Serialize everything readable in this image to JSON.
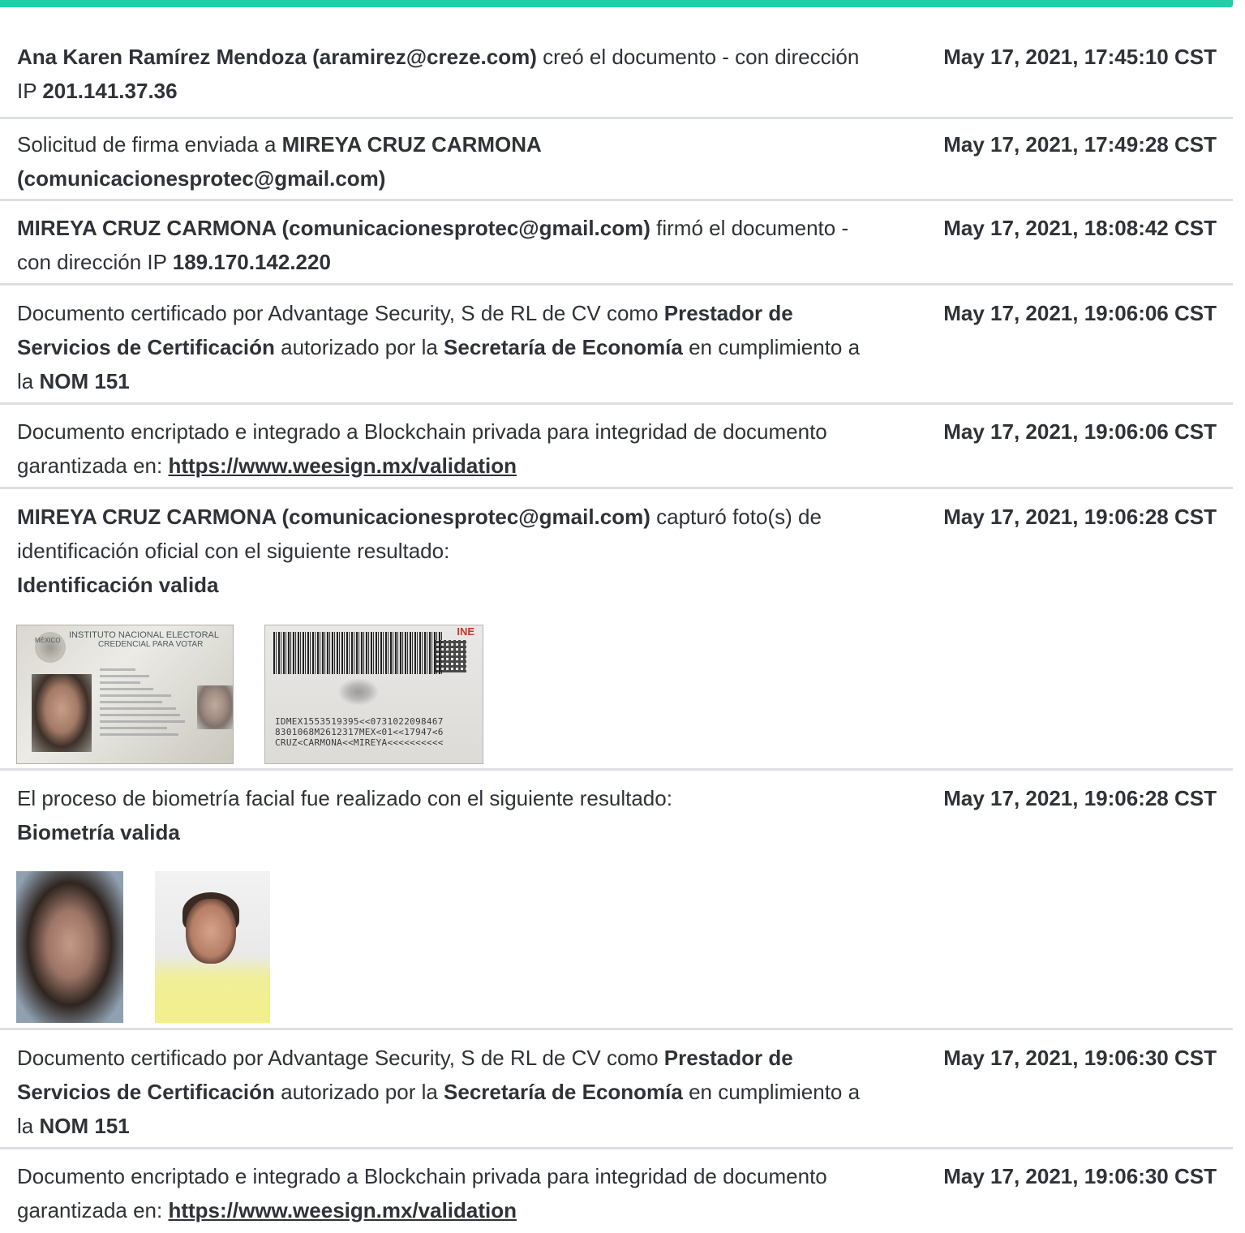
{
  "accent_color": "#20cfa8",
  "events": [
    {
      "parts": [
        {
          "t": "Ana Karen Ramírez Mendoza (aramirez@creze.com)",
          "b": true
        },
        {
          "t": " creó el documento - con dirección IP "
        },
        {
          "t": "201.141.37.36",
          "b": true
        }
      ],
      "date": "May 17, 2021, 17:45:10 CST"
    },
    {
      "parts": [
        {
          "t": "Solicitud de firma enviada a "
        },
        {
          "t": "MIREYA CRUZ CARMONA (comunicacionesprotec@gmail.com)",
          "b": true
        }
      ],
      "date": "May 17, 2021, 17:49:28 CST"
    },
    {
      "parts": [
        {
          "t": "MIREYA CRUZ CARMONA (comunicacionesprotec@gmail.com)",
          "b": true
        },
        {
          "t": " firmó el documento - con dirección IP "
        },
        {
          "t": "189.170.142.220",
          "b": true
        }
      ],
      "date": "May 17, 2021, 18:08:42 CST"
    },
    {
      "parts": [
        {
          "t": "Documento certificado por Advantage Security, S de RL de CV como "
        },
        {
          "t": "Prestador de Servicios de Certificación",
          "b": true
        },
        {
          "t": " autorizado por la "
        },
        {
          "t": "Secretaría de Economía",
          "b": true
        },
        {
          "t": " en cumplimiento a la "
        },
        {
          "t": "NOM 151",
          "b": true
        }
      ],
      "date": "May 17, 2021, 19:06:06 CST"
    },
    {
      "parts": [
        {
          "t": "Documento encriptado e integrado a Blockchain privada para integridad de documento garantizada en: "
        },
        {
          "t": "https://www.weesign.mx/validation",
          "link": true
        }
      ],
      "date": "May 17, 2021, 19:06:06 CST"
    },
    {
      "parts": [
        {
          "t": "MIREYA CRUZ CARMONA (comunicacionesprotec@gmail.com)",
          "b": true
        },
        {
          "t": " capturó foto(s) de identificación oficial con el siguiente resultado:"
        },
        {
          "br": true
        },
        {
          "t": "Identificación valida",
          "b": true
        }
      ],
      "date": "May 17, 2021, 19:06:28 CST"
    },
    {
      "parts": [
        {
          "t": "El proceso de biometría facial fue realizado con el siguiente resultado:"
        },
        {
          "br": true
        },
        {
          "t": "Biometría valida",
          "b": true
        }
      ],
      "date": "May 17, 2021, 19:06:28 CST"
    },
    {
      "parts": [
        {
          "t": "Documento certificado por Advantage Security, S de RL de CV como "
        },
        {
          "t": "Prestador de Servicios de Certificación",
          "b": true
        },
        {
          "t": " autorizado por la "
        },
        {
          "t": "Secretaría de Economía",
          "b": true
        },
        {
          "t": " en cumplimiento a la "
        },
        {
          "t": "NOM 151",
          "b": true
        }
      ],
      "date": "May 17, 2021, 19:06:30 CST"
    },
    {
      "parts": [
        {
          "t": "Documento encriptado e integrado a Blockchain privada para integridad de documento garantizada en: "
        },
        {
          "t": "https://www.weesign.mx/validation",
          "link": true
        }
      ],
      "date": "May 17, 2021, 19:06:30 CST"
    }
  ],
  "id_card": {
    "front_title": "INSTITUTO NACIONAL ELECTORAL",
    "front_subtitle": "CREDENCIAL PARA VOTAR",
    "country": "MÉXICO",
    "back_logo": "INE",
    "mrz": [
      "IDMEX1553519395<<0731022098467",
      "8301068M2612317MEX<01<<17947<6",
      "CRUZ<CARMONA<<MIREYA<<<<<<<<<<"
    ]
  }
}
